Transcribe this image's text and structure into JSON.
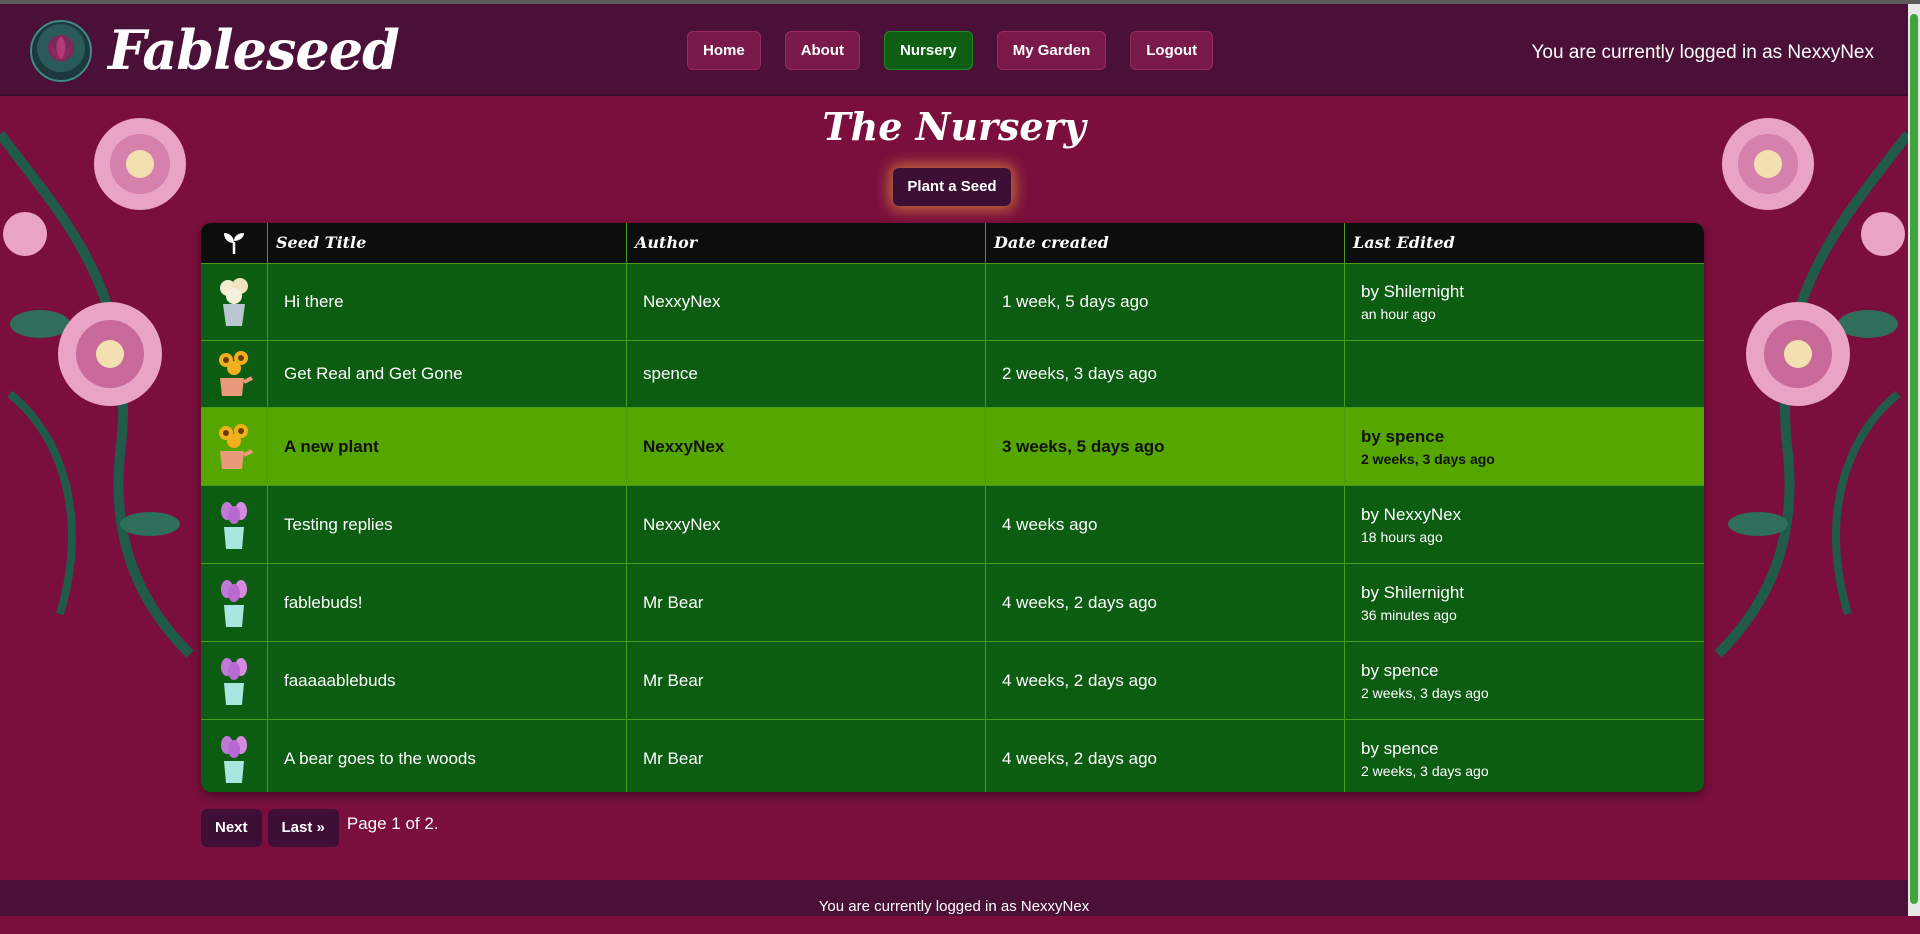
{
  "header": {
    "brand": "Fableseed",
    "nav": [
      "Home",
      "About",
      "Nursery",
      "My Garden",
      "Logout"
    ],
    "active_nav": "Nursery",
    "login_status": "You are currently logged in as NexxyNex"
  },
  "main": {
    "title": "The Nursery",
    "plant_button": "Plant a Seed",
    "table": {
      "icon_header": "sprout-icon",
      "headers": [
        "Seed Title",
        "Author",
        "Date created",
        "Last Edited"
      ],
      "rows": [
        {
          "icon": "flower-bucket-white-icon",
          "title": "Hi there",
          "author": "NexxyNex",
          "created": "1 week, 5 days ago",
          "edited_by": "by Shilernight",
          "edited_ago": "an hour ago"
        },
        {
          "icon": "sunflower-can-icon",
          "title": "Get Real and Get Gone",
          "author": "spence",
          "created": "2 weeks, 3 days ago",
          "edited_by": "",
          "edited_ago": ""
        },
        {
          "icon": "sunflower-can-icon",
          "title": "A new plant",
          "author": "NexxyNex",
          "created": "3 weeks, 5 days ago",
          "edited_by": "by spence",
          "edited_ago": "2 weeks, 3 days ago"
        },
        {
          "icon": "tulip-bucket-icon",
          "title": "Testing replies",
          "author": "NexxyNex",
          "created": "4 weeks ago",
          "edited_by": "by NexxyNex",
          "edited_ago": "18 hours ago"
        },
        {
          "icon": "tulip-bucket-icon",
          "title": "fablebuds!",
          "author": "Mr Bear",
          "created": "4 weeks, 2 days ago",
          "edited_by": "by Shilernight",
          "edited_ago": "36 minutes ago"
        },
        {
          "icon": "tulip-bucket-icon",
          "title": "faaaaablebuds",
          "author": "Mr Bear",
          "created": "4 weeks, 2 days ago",
          "edited_by": "by spence",
          "edited_ago": "2 weeks, 3 days ago"
        },
        {
          "icon": "tulip-bucket-icon",
          "title": "A bear goes to the woods",
          "author": "Mr Bear",
          "created": "4 weeks, 2 days ago",
          "edited_by": "by spence",
          "edited_ago": "2 weeks, 3 days ago"
        }
      ]
    }
  },
  "pagination": {
    "next": "Next",
    "last": "Last »",
    "status": "Page 1 of 2."
  },
  "footer": {
    "login_status": "You are currently logged in as NexxyNex"
  },
  "colors": {
    "background": "#7a0f3d",
    "header": "#4a1038",
    "table_row": "#0c5c12",
    "highlight_row": "#56a600",
    "active_nav": "#0f5e14"
  }
}
